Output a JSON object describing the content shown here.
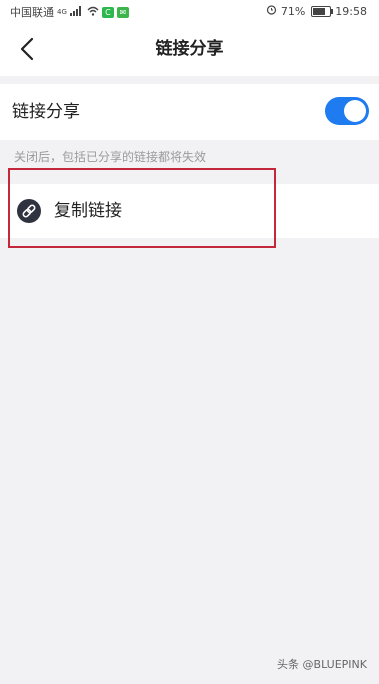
{
  "status_bar": {
    "carrier": "中国联通",
    "network": "4G",
    "battery": "71%",
    "battery_level": 0.71,
    "time": "19:58",
    "icons": [
      "signal-icon",
      "wifi-icon",
      "app-badge-icon",
      "alarm-icon",
      "battery-icon"
    ]
  },
  "header": {
    "title": "链接分享",
    "back_icon": "chevron-left-icon"
  },
  "link_share_setting": {
    "label": "链接分享",
    "enabled": true,
    "hint": "关闭后，包括已分享的链接都将失效"
  },
  "copy_link": {
    "label": "复制链接",
    "icon": "link-icon"
  },
  "colors": {
    "accent": "#1e7bf0",
    "highlight_border": "#c4283a",
    "background": "#f2f2f4"
  },
  "watermark": "头条 @BLUEPINK"
}
